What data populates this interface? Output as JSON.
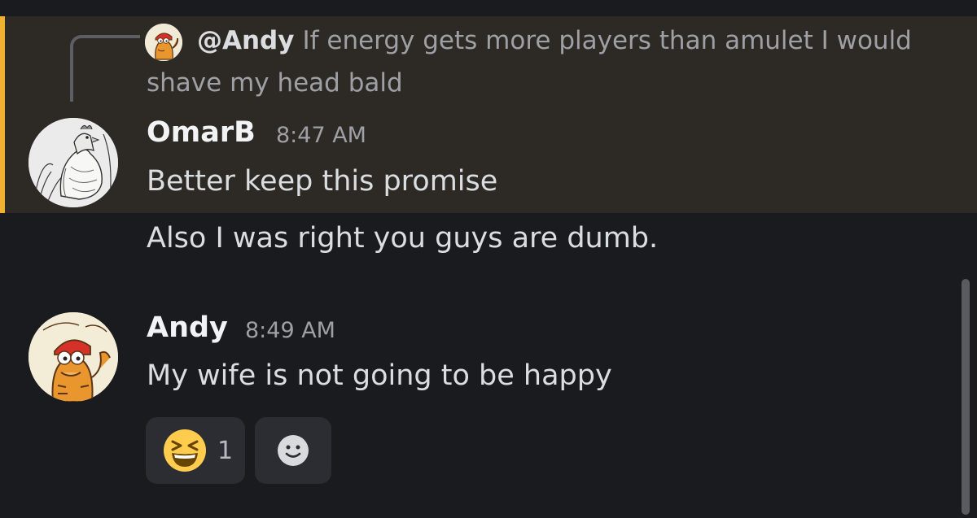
{
  "reply": {
    "mention": "@Andy",
    "text": "If energy gets more players than amulet I would shave my head bald"
  },
  "messages": [
    {
      "username": "OmarB",
      "timestamp": "8:47 AM",
      "lines": [
        "Better keep this promise",
        "Also I was right you guys are dumb."
      ]
    },
    {
      "username": "Andy",
      "timestamp": "8:49 AM",
      "lines": [
        "My wife is not going to be happy"
      ]
    }
  ],
  "reactions": [
    {
      "icon": "laughing-squint-emoji-icon",
      "count": "1"
    },
    {
      "icon": "add-reaction-smiley-icon"
    }
  ],
  "colors": {
    "highlight_bar": "#f0b132",
    "highlight_bg": "#2d2a25",
    "background": "#1a1b1f"
  }
}
